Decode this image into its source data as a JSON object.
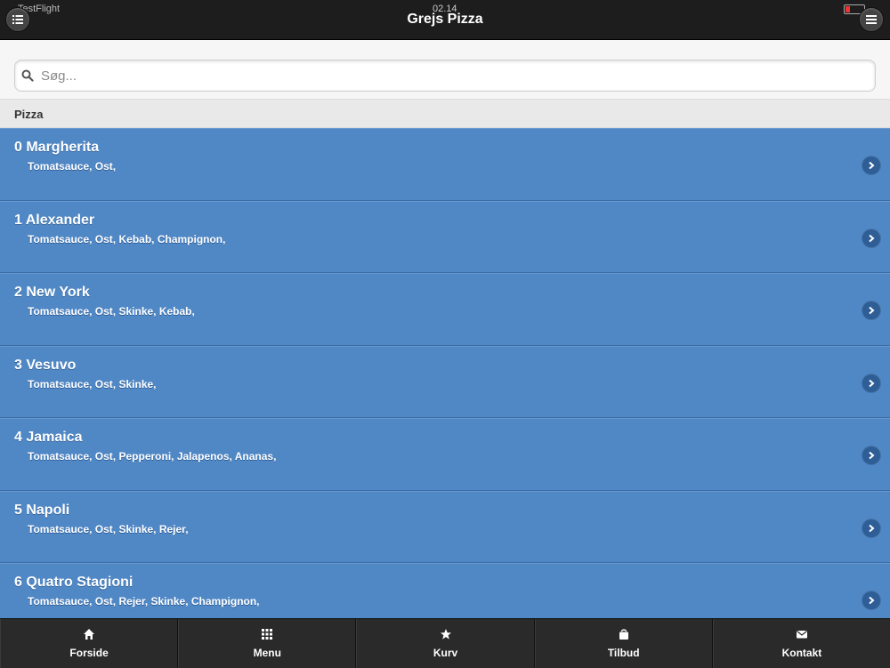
{
  "status_bar": {
    "carrier": "TestFlight",
    "time": "02.14",
    "battery_label": ""
  },
  "header": {
    "title": "Grejs Pizza"
  },
  "search": {
    "placeholder": "Søg...",
    "value": ""
  },
  "list": {
    "divider": "Pizza",
    "items": [
      {
        "title": "0 Margherita",
        "ingredients": "Tomatsauce, Ost,"
      },
      {
        "title": "1 Alexander",
        "ingredients": "Tomatsauce, Ost, Kebab, Champignon,"
      },
      {
        "title": "2 New York",
        "ingredients": "Tomatsauce, Ost, Skinke, Kebab,"
      },
      {
        "title": "3 Vesuvo",
        "ingredients": "Tomatsauce, Ost, Skinke,"
      },
      {
        "title": "4 Jamaica",
        "ingredients": "Tomatsauce, Ost, Pepperoni, Jalapenos, Ananas,"
      },
      {
        "title": "5 Napoli",
        "ingredients": "Tomatsauce, Ost, Skinke, Rejer,"
      },
      {
        "title": "6 Quatro Stagioni",
        "ingredients": "Tomatsauce, Ost, Rejer, Skinke, Champignon,"
      }
    ]
  },
  "navbar": {
    "items": [
      {
        "label": "Forside",
        "icon": "home-icon"
      },
      {
        "label": "Menu",
        "icon": "grid-icon"
      },
      {
        "label": "Kurv",
        "icon": "star-icon"
      },
      {
        "label": "Tilbud",
        "icon": "bag-icon"
      },
      {
        "label": "Kontakt",
        "icon": "mail-icon"
      }
    ]
  },
  "colors": {
    "list_item": "#5088c6",
    "header": "#1d1d1d",
    "navbar": "#2a2a2a"
  }
}
